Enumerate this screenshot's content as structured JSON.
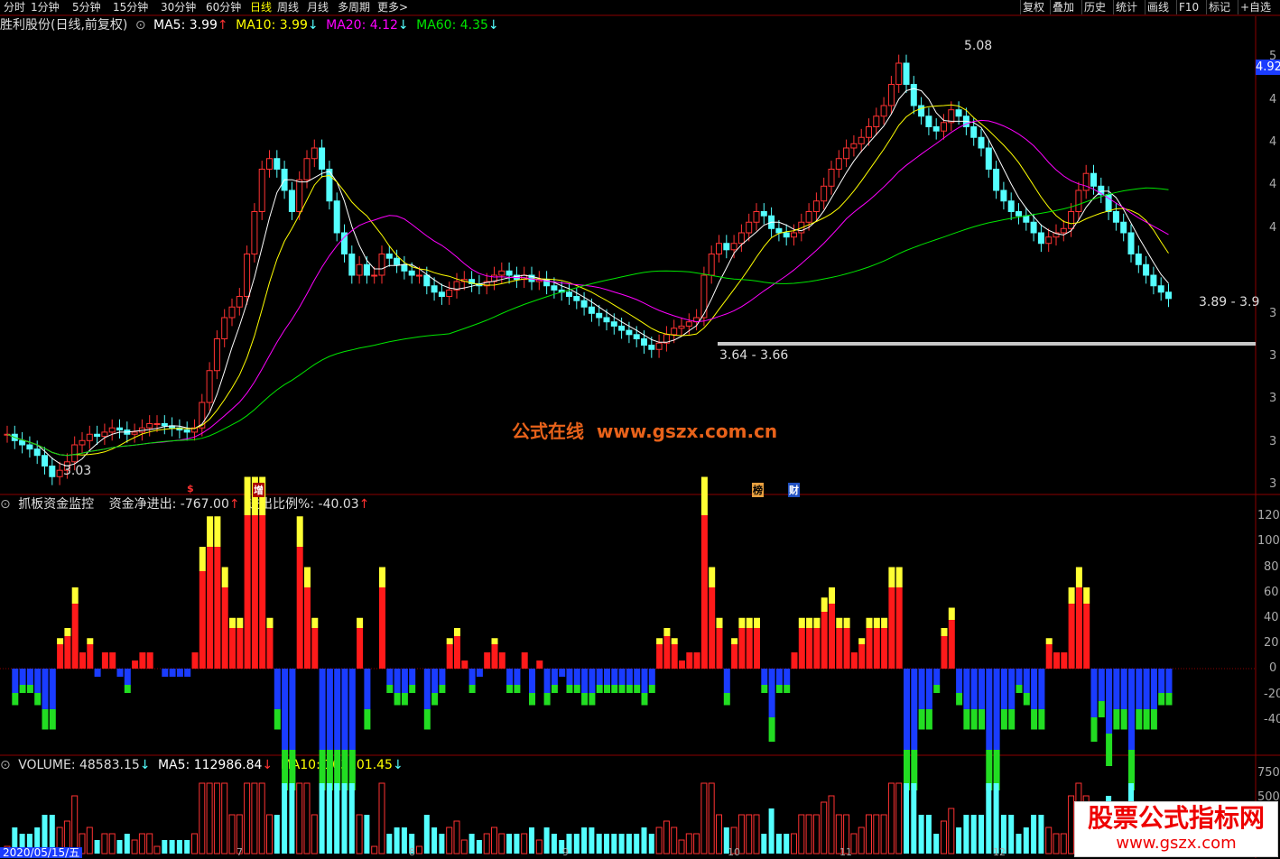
{
  "toolbar": {
    "periods": [
      "分时",
      "1分钟",
      "5分钟",
      "15分钟",
      "30分钟",
      "60分钟",
      "日线",
      "周线",
      "月线",
      "多周期",
      "更多>"
    ],
    "active_period": "日线",
    "right_buttons": [
      "复权",
      "叠加",
      "历史",
      "统计",
      "画线",
      "F10",
      "标记",
      "+自选"
    ]
  },
  "main": {
    "stock_title": "胜利股份(日线,前复权)",
    "ma5": "MA5: 3.99",
    "ma10": "MA10: 3.99",
    "ma20": "MA20: 4.12",
    "ma60": "MA60: 4.35",
    "price_tag": "4.92",
    "high_label": "5.08",
    "low_label_left": "3.03",
    "low_label_mid": "3.64 - 3.66",
    "range_label_right": "3.89 - 3.9",
    "watermark": "公式在线  www.gszx.com.cn",
    "markers": [
      "$",
      "增",
      "榜",
      "财"
    ],
    "y_ticks": [
      "5",
      "4",
      "4",
      "4",
      "4",
      "3",
      "3",
      "3",
      "3",
      "3"
    ]
  },
  "indicator": {
    "name": "抓板资金监控",
    "net_flow": "资金净进出: -767.00",
    "ratio": "进出比例%: -40.03",
    "y_ticks": [
      "120",
      "100",
      "80",
      "60",
      "40",
      "20",
      "0",
      "-20",
      "-40"
    ]
  },
  "volume": {
    "vol": "VOLUME: 48583.15",
    "ma5": "MA5: 112986.84",
    "ma10": "MA10: 103101.45",
    "y_ticks": [
      "750",
      "500"
    ],
    "date": "2020/05/15/五",
    "x_ticks": [
      "7",
      "8",
      "9",
      "10",
      "11",
      "12"
    ]
  },
  "logo": {
    "title": "股票公式指标网",
    "url": "www.gszx.com"
  },
  "colors": {
    "up": "#ff3232",
    "down": "#54ffff",
    "ma5": "#ffffff",
    "ma10": "#ffff00",
    "ma20": "#ff00ff",
    "ma60": "#00e600",
    "bar_red": "#ff1a1a",
    "bar_yellow": "#ffff33",
    "bar_blue": "#1a3cff",
    "bar_green": "#22dd22"
  }
}
